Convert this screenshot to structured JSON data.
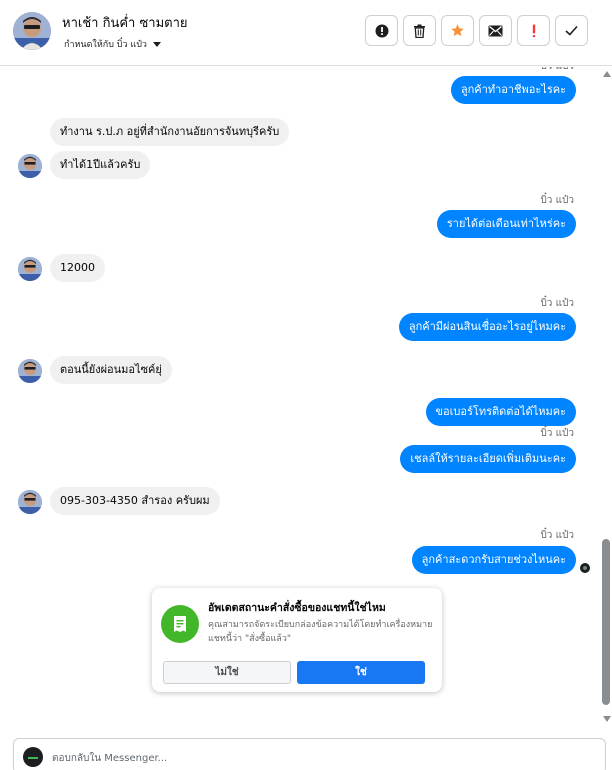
{
  "header": {
    "contact_name": "หาเช้า กินค่ำ ซามตาย",
    "assign_label": "กำหนดให้กับ บิ๋ว แป๋ว",
    "toolbar": [
      {
        "name": "report-icon-button",
        "icon": "exclamation-circle-icon"
      },
      {
        "name": "delete-button",
        "icon": "trash-icon"
      },
      {
        "name": "star-button",
        "icon": "star-icon"
      },
      {
        "name": "mark-unread-button",
        "icon": "envelope-icon"
      },
      {
        "name": "spam-button",
        "icon": "exclamation-icon"
      },
      {
        "name": "done-button",
        "icon": "checkmark-icon"
      }
    ]
  },
  "colors": {
    "outgoing_bubble": "#0084ff",
    "incoming_bubble": "#f0f0f0",
    "accent_blue": "#1877f2",
    "star": "#f7923b",
    "spam": "#fa383e",
    "card_icon": "#42b72a"
  },
  "conversation": {
    "sender_name": "บิ๋ว แป๋ว",
    "messages": [
      {
        "dir": "out",
        "text": "ลูกค้าทำอาชีพอะไรคะ"
      },
      {
        "dir": "in",
        "text": "ทำงาน ร.ป.ภ อยู่ที่สำนักงานอัยการจันทบุรีครับ"
      },
      {
        "dir": "in",
        "text": "ทำได้1ปีแล้วครับ"
      },
      {
        "dir": "out",
        "text": "รายได้ต่อเดือนเท่าไหร่คะ"
      },
      {
        "dir": "in",
        "text": "12000"
      },
      {
        "dir": "out",
        "text": "ลูกค้ามีผ่อนสินเชื่ออะไรอยู่ไหมคะ"
      },
      {
        "dir": "in",
        "text": "ตอนนี้ยังผ่อนมอไซค์ยุ่"
      },
      {
        "dir": "out",
        "text": "ขอเบอร์โทรติดต่อได้ไหมคะ"
      },
      {
        "dir": "out",
        "text": "เชลล์ให้รายละเอียดเพิ่มเติมนะคะ"
      },
      {
        "dir": "in",
        "text": "095-303-4350 สำรอง ครับผม"
      },
      {
        "dir": "out",
        "text": "ลูกค้าสะดวกรับสายช่วงไหนคะ"
      }
    ]
  },
  "prompt_card": {
    "title": "อัพเดตสถานะคำสั่งซื้อของแชทนี้ใช่ไหม",
    "body": "คุณสามารถจัดระเบียบกล่องข้อความได้โดยทำเครื่องหมายแชทนี้ว่า \"สั่งซื้อแล้ว\"",
    "no_label": "ไม่ใช่",
    "yes_label": "ใช่",
    "icon": "order-receipt-icon"
  },
  "composer": {
    "placeholder": "ตอบกลับใน Messenger..."
  }
}
